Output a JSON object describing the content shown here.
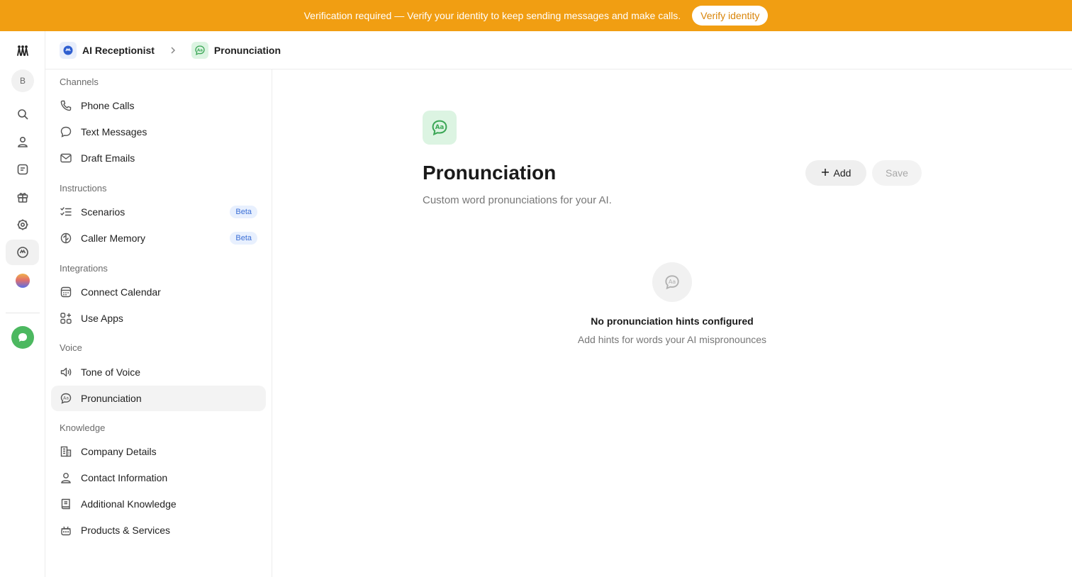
{
  "banner": {
    "text": "Verification required — Verify your identity to keep sending messages and make calls.",
    "button_label": "Verify identity"
  },
  "rail": {
    "avatar_initial": "B",
    "icons": [
      "logo-icon",
      "search-icon",
      "contacts-icon",
      "inbox-icon",
      "gift-icon",
      "settings-icon",
      "ai-receptionist-icon",
      "gradient-app-icon",
      "chat-icon"
    ]
  },
  "breadcrumb": {
    "items": [
      {
        "label": "AI Receptionist"
      },
      {
        "label": "Pronunciation"
      }
    ]
  },
  "sidebar": {
    "sections": [
      {
        "label": "Channels",
        "items": [
          {
            "label": "Phone Calls",
            "icon": "phone-icon"
          },
          {
            "label": "Text Messages",
            "icon": "message-icon"
          },
          {
            "label": "Draft Emails",
            "icon": "mail-icon"
          }
        ]
      },
      {
        "label": "Instructions",
        "items": [
          {
            "label": "Scenarios",
            "icon": "checklist-icon",
            "badge": "Beta"
          },
          {
            "label": "Caller Memory",
            "icon": "brain-icon",
            "badge": "Beta"
          }
        ]
      },
      {
        "label": "Integrations",
        "items": [
          {
            "label": "Connect Calendar",
            "icon": "calendar-icon"
          },
          {
            "label": "Use Apps",
            "icon": "apps-icon"
          }
        ]
      },
      {
        "label": "Voice",
        "items": [
          {
            "label": "Tone of Voice",
            "icon": "speaker-icon"
          },
          {
            "label": "Pronunciation",
            "icon": "pronunciation-icon",
            "active": true
          }
        ]
      },
      {
        "label": "Knowledge",
        "items": [
          {
            "label": "Company Details",
            "icon": "building-icon"
          },
          {
            "label": "Contact Information",
            "icon": "person-icon"
          },
          {
            "label": "Additional Knowledge",
            "icon": "book-icon"
          },
          {
            "label": "Products & Services",
            "icon": "basket-icon"
          }
        ]
      }
    ]
  },
  "main": {
    "title": "Pronunciation",
    "subtitle": "Custom word pronunciations for your AI.",
    "add_label": "Add",
    "save_label": "Save",
    "empty_title": "No pronunciation hints configured",
    "empty_subtitle": "Add hints for words your AI mispronounces"
  },
  "colors": {
    "banner": "#F19E12",
    "accent_green": "#4CB860",
    "beta_blue": "#3c6fd6"
  }
}
